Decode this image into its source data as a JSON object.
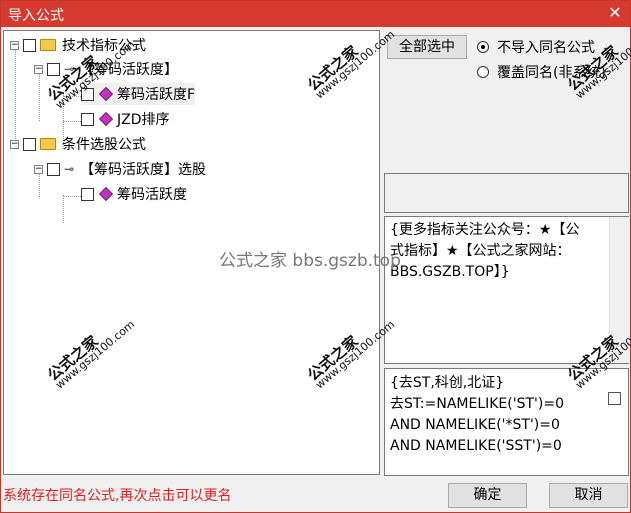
{
  "window": {
    "title": "导入公式",
    "close": "✕"
  },
  "tree": {
    "items": [
      {
        "label": "技术指标公式"
      },
      {
        "label": "【筹码活跃度】"
      },
      {
        "label": "筹码活跃度F"
      },
      {
        "label": "JZD排序"
      },
      {
        "label": "条件选股公式"
      },
      {
        "label": "【筹码活跃度】选股"
      },
      {
        "label": "筹码活跃度"
      }
    ]
  },
  "right": {
    "select_all": "全部选中",
    "radio_options": [
      "不导入同名公式",
      "覆盖同名(非系统)"
    ]
  },
  "desc": {
    "lines": [
      "{更多指标关注公众号：★【公",
      "式指标】★【公式之家网站：",
      "BBS.GSZB.TOP】}"
    ]
  },
  "code": {
    "lines": [
      "{去ST,科创,北证}",
      "去ST:=NAMELIKE('ST')=0",
      "AND NAMELIKE('*ST')=0",
      "AND NAMELIKE('SST')=0"
    ]
  },
  "footer": {
    "status": "系统存在同名公式,再次点击可以更名",
    "ok": "确定",
    "cancel": "取消"
  },
  "watermark": {
    "brand": "公式之家",
    "url": "www.gszj100.com",
    "center": "公式之家 bbs.gszb.top"
  }
}
